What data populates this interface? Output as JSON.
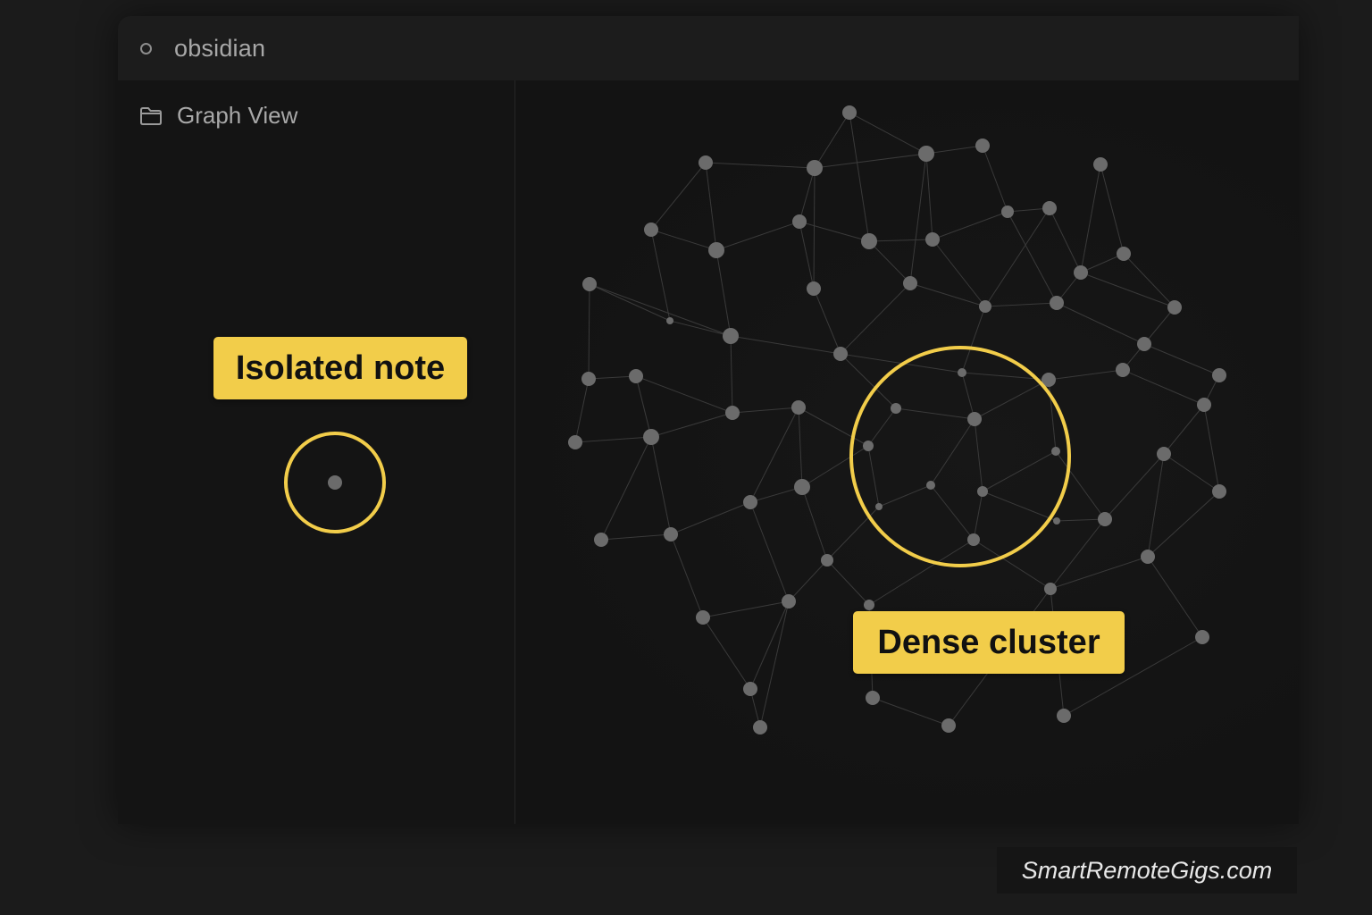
{
  "app": {
    "title": "obsidian",
    "icon": "circle-icon"
  },
  "sidebar": {
    "items": [
      {
        "label": "Graph View",
        "icon": "folder-icon"
      }
    ]
  },
  "annotations": {
    "isolated_label": "Isolated note",
    "dense_label": "Dense cluster",
    "highlight_color": "#f2cd4a"
  },
  "watermark": {
    "text": "SmartRemoteGigs.com"
  },
  "colors": {
    "background": "#141414",
    "node": "#6b6b6b",
    "edge": "#3a3a3a",
    "accent": "#f2cd4a",
    "text": "#a8a8a8"
  }
}
